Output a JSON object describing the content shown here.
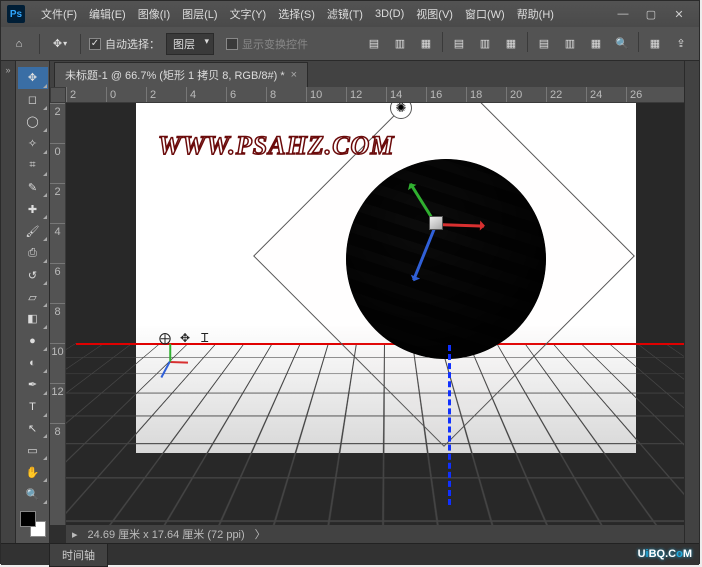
{
  "menu": [
    "文件(F)",
    "编辑(E)",
    "图像(I)",
    "图层(L)",
    "文字(Y)",
    "选择(S)",
    "滤镜(T)",
    "3D(D)",
    "视图(V)",
    "窗口(W)",
    "帮助(H)"
  ],
  "optbar": {
    "auto_select_label": "自动选择：",
    "auto_select_value": "图层",
    "show_transform_label": "显示变换控件"
  },
  "tab": {
    "title": "未标题-1 @ 66.7% (矩形 1 拷贝 8, RGB/8#) *"
  },
  "ruler_h": [
    "2",
    "0",
    "2",
    "4",
    "6",
    "8",
    "10",
    "12",
    "14",
    "16",
    "18",
    "20",
    "22",
    "24",
    "26"
  ],
  "ruler_v": [
    "2",
    "0",
    "2",
    "4",
    "6",
    "8",
    "10",
    "12",
    "8"
  ],
  "canvas": {
    "watermark": "WWW.PSAHZ.COM"
  },
  "status": {
    "value": "24.69 厘米 x 17.64 厘米 (72 ppi)",
    "arrow": "〉"
  },
  "bottom": {
    "timeline": "时间轴"
  },
  "brand": {
    "text": "UiBQ.CoM"
  },
  "icons": {
    "home": "⌂",
    "move": "✥",
    "chev": "▾",
    "align_l": "▤",
    "align_c": "▥",
    "align_r": "▦",
    "3d": "⧈",
    "ruler": "📏",
    "grid": "▦",
    "share": "⇪",
    "marquee": "◻",
    "lasso": "◯",
    "wand": "✧",
    "crop": "⌗",
    "eyedrop": "✎",
    "heal": "✚",
    "brush": "🖌",
    "stamp": "⎙",
    "history": "↺",
    "eraser": "▱",
    "gradient": "◧",
    "blur": "●",
    "dodge": "◐",
    "pen": "✒",
    "type": "T",
    "path": "↖",
    "rect": "▭",
    "hand": "✋",
    "zoom": "🔍",
    "globe": "⨁",
    "move2": "✥",
    "cursor": "Ꮖ",
    "sun": "✺"
  }
}
